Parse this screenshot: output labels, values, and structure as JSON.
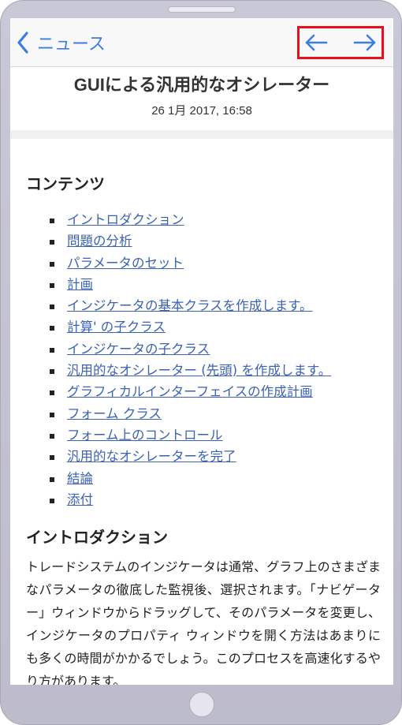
{
  "navbar": {
    "back_label": "ニュース",
    "prev_icon": "arrow-left-icon",
    "next_icon": "arrow-right-icon",
    "accent_color": "#3b7ee0"
  },
  "article": {
    "title": "GUIによる汎用的なオシレーター",
    "date": "26 1月 2017, 16:58"
  },
  "toc": {
    "heading": "コンテンツ",
    "items": [
      "イントロダクション",
      "問題の分析",
      "パラメータのセット",
      "計画",
      "インジケータの基本クラスを作成します。",
      "計算' の子クラス",
      "インジケータの子クラス",
      "汎用的なオシレーター (先頭) を作成します。",
      "グラフィカルインターフェイスの作成計画",
      "フォーム クラス",
      "フォーム上のコントロール",
      "汎用的なオシレーターを完了",
      "結論",
      "添付"
    ]
  },
  "intro": {
    "heading": "イントロダクション",
    "text": "トレードシステムのインジケータは通常、グラフ上のさまざまなパラメータの徹底した監視後、選択されます。「ナビゲーター」ウィンドウからドラッグして、そのパラメータを変更し、インジケータのプロパティ ウィンドウを開く方法はあまりにも多くの時間がかかるでしょう。このプロセスを高速化するやり方があります。"
  }
}
